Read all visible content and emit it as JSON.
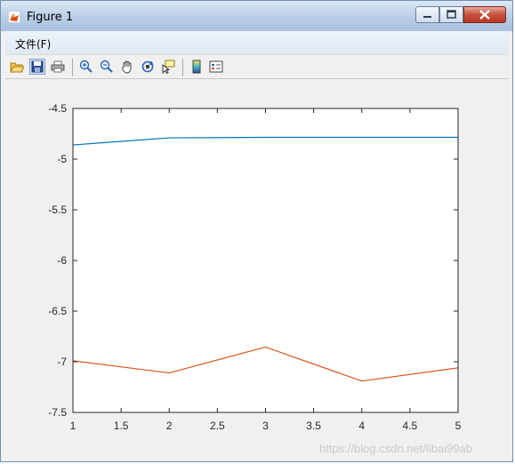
{
  "window": {
    "title": "Figure 1",
    "menu": [
      "文件(F)"
    ]
  },
  "toolbar": {
    "icons": [
      "open-folder-icon",
      "save-icon",
      "print-icon",
      "zoom-in-icon",
      "zoom-out-icon",
      "pan-hand-icon",
      "rotate-3d-icon",
      "data-cursor-icon",
      "colorbar-icon",
      "legend-icon"
    ]
  },
  "watermark": "https://blog.csdn.net/libai99ab",
  "chart_data": {
    "type": "line",
    "x": [
      1,
      2,
      3,
      4,
      5
    ],
    "series": [
      {
        "values": [
          -4.86,
          -4.79,
          -4.785,
          -4.785,
          -4.785
        ],
        "color": "#0072bd"
      },
      {
        "values": [
          -6.99,
          -7.11,
          -6.855,
          -7.19,
          -7.06
        ],
        "color": "#d95319"
      }
    ],
    "xlim": [
      1,
      5
    ],
    "ylim": [
      -7.5,
      -4.5
    ],
    "xticks": [
      "1",
      "1.5",
      "2",
      "2.5",
      "3",
      "3.5",
      "4",
      "4.5",
      "5"
    ],
    "yticks": [
      "-4.5",
      "-5",
      "-5.5",
      "-6",
      "-6.5",
      "-7",
      "-7.5"
    ],
    "grid": false,
    "title": "",
    "xlabel": "",
    "ylabel": ""
  }
}
